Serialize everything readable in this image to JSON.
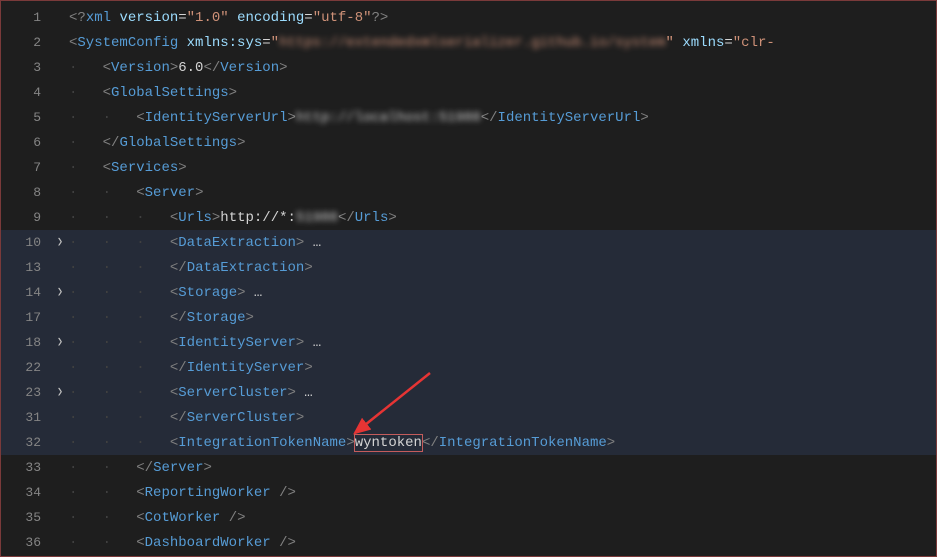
{
  "lines": [
    {
      "num": "1",
      "hl": false,
      "fold": "",
      "indent": 0,
      "tokens": [
        {
          "t": "tag-bracket",
          "v": "<?"
        },
        {
          "t": "tag-name",
          "v": "xml"
        },
        {
          "t": "text",
          "v": " "
        },
        {
          "t": "attr",
          "v": "version"
        },
        {
          "t": "text",
          "v": "="
        },
        {
          "t": "attr-val",
          "v": "\"1.0\""
        },
        {
          "t": "text",
          "v": " "
        },
        {
          "t": "attr",
          "v": "encoding"
        },
        {
          "t": "text",
          "v": "="
        },
        {
          "t": "attr-val",
          "v": "\"utf-8\""
        },
        {
          "t": "tag-bracket",
          "v": "?>"
        }
      ]
    },
    {
      "num": "2",
      "hl": false,
      "fold": "",
      "indent": 0,
      "tokens": [
        {
          "t": "tag-bracket",
          "v": "<"
        },
        {
          "t": "tag-name",
          "v": "SystemConfig"
        },
        {
          "t": "text",
          "v": " "
        },
        {
          "t": "attr",
          "v": "xmlns:sys"
        },
        {
          "t": "text",
          "v": "="
        },
        {
          "t": "attr-val",
          "v": "\""
        },
        {
          "t": "blur",
          "v": "https://extendedxmlserializer.github.io/system"
        },
        {
          "t": "attr-val",
          "v": "\""
        },
        {
          "t": "text",
          "v": " "
        },
        {
          "t": "attr",
          "v": "xmlns"
        },
        {
          "t": "text",
          "v": "="
        },
        {
          "t": "attr-val",
          "v": "\"clr-"
        }
      ]
    },
    {
      "num": "3",
      "hl": false,
      "fold": "",
      "indent": 1,
      "tokens": [
        {
          "t": "tag-bracket",
          "v": "<"
        },
        {
          "t": "tag-name",
          "v": "Version"
        },
        {
          "t": "tag-bracket",
          "v": ">"
        },
        {
          "t": "text",
          "v": "6.0"
        },
        {
          "t": "tag-bracket",
          "v": "</"
        },
        {
          "t": "tag-name",
          "v": "Version"
        },
        {
          "t": "tag-bracket",
          "v": ">"
        }
      ]
    },
    {
      "num": "4",
      "hl": false,
      "fold": "",
      "indent": 1,
      "tokens": [
        {
          "t": "tag-bracket",
          "v": "<"
        },
        {
          "t": "tag-name",
          "v": "GlobalSettings"
        },
        {
          "t": "tag-bracket",
          "v": ">"
        }
      ]
    },
    {
      "num": "5",
      "hl": false,
      "fold": "",
      "indent": 2,
      "tokens": [
        {
          "t": "tag-bracket",
          "v": "<"
        },
        {
          "t": "tag-name",
          "v": "IdentityServerUrl"
        },
        {
          "t": "tag-bracket",
          "v": ">"
        },
        {
          "t": "blur2",
          "v": "http://localhost:51980"
        },
        {
          "t": "tag-bracket",
          "v": "</"
        },
        {
          "t": "tag-name",
          "v": "IdentityServerUrl"
        },
        {
          "t": "tag-bracket",
          "v": ">"
        }
      ]
    },
    {
      "num": "6",
      "hl": false,
      "fold": "",
      "indent": 1,
      "tokens": [
        {
          "t": "tag-bracket",
          "v": "</"
        },
        {
          "t": "tag-name",
          "v": "GlobalSettings"
        },
        {
          "t": "tag-bracket",
          "v": ">"
        }
      ]
    },
    {
      "num": "7",
      "hl": false,
      "fold": "",
      "indent": 1,
      "tokens": [
        {
          "t": "tag-bracket",
          "v": "<"
        },
        {
          "t": "tag-name",
          "v": "Services"
        },
        {
          "t": "tag-bracket",
          "v": ">"
        }
      ]
    },
    {
      "num": "8",
      "hl": false,
      "fold": "",
      "indent": 2,
      "tokens": [
        {
          "t": "tag-bracket",
          "v": "<"
        },
        {
          "t": "tag-name",
          "v": "Server"
        },
        {
          "t": "tag-bracket",
          "v": ">"
        }
      ]
    },
    {
      "num": "9",
      "hl": false,
      "fold": "",
      "indent": 3,
      "tokens": [
        {
          "t": "tag-bracket",
          "v": "<"
        },
        {
          "t": "tag-name",
          "v": "Urls"
        },
        {
          "t": "tag-bracket",
          "v": ">"
        },
        {
          "t": "text",
          "v": "http://*:"
        },
        {
          "t": "blur2",
          "v": "51980"
        },
        {
          "t": "tag-bracket",
          "v": "</"
        },
        {
          "t": "tag-name",
          "v": "Urls"
        },
        {
          "t": "tag-bracket",
          "v": ">"
        }
      ]
    },
    {
      "num": "10",
      "hl": true,
      "fold": ">",
      "indent": 3,
      "tokens": [
        {
          "t": "tag-bracket",
          "v": "<"
        },
        {
          "t": "tag-name",
          "v": "DataExtraction"
        },
        {
          "t": "tag-bracket",
          "v": ">"
        },
        {
          "t": "ell",
          "v": " …"
        }
      ]
    },
    {
      "num": "13",
      "hl": true,
      "fold": "",
      "indent": 3,
      "tokens": [
        {
          "t": "tag-bracket",
          "v": "</"
        },
        {
          "t": "tag-name",
          "v": "DataExtraction"
        },
        {
          "t": "tag-bracket",
          "v": ">"
        }
      ]
    },
    {
      "num": "14",
      "hl": true,
      "fold": ">",
      "indent": 3,
      "tokens": [
        {
          "t": "tag-bracket",
          "v": "<"
        },
        {
          "t": "tag-name",
          "v": "Storage"
        },
        {
          "t": "tag-bracket",
          "v": ">"
        },
        {
          "t": "ell",
          "v": " …"
        }
      ]
    },
    {
      "num": "17",
      "hl": true,
      "fold": "",
      "indent": 3,
      "tokens": [
        {
          "t": "tag-bracket",
          "v": "</"
        },
        {
          "t": "tag-name",
          "v": "Storage"
        },
        {
          "t": "tag-bracket",
          "v": ">"
        }
      ]
    },
    {
      "num": "18",
      "hl": true,
      "fold": ">",
      "indent": 3,
      "tokens": [
        {
          "t": "tag-bracket",
          "v": "<"
        },
        {
          "t": "tag-name",
          "v": "IdentityServer"
        },
        {
          "t": "tag-bracket",
          "v": ">"
        },
        {
          "t": "ell",
          "v": " …"
        }
      ]
    },
    {
      "num": "22",
      "hl": true,
      "fold": "",
      "indent": 3,
      "tokens": [
        {
          "t": "tag-bracket",
          "v": "</"
        },
        {
          "t": "tag-name",
          "v": "IdentityServer"
        },
        {
          "t": "tag-bracket",
          "v": ">"
        }
      ]
    },
    {
      "num": "23",
      "hl": true,
      "fold": ">",
      "indent": 3,
      "tokens": [
        {
          "t": "tag-bracket",
          "v": "<"
        },
        {
          "t": "tag-name",
          "v": "ServerCluster"
        },
        {
          "t": "tag-bracket",
          "v": ">"
        },
        {
          "t": "ell",
          "v": " …"
        }
      ]
    },
    {
      "num": "31",
      "hl": true,
      "fold": "",
      "indent": 3,
      "tokens": [
        {
          "t": "tag-bracket",
          "v": "</"
        },
        {
          "t": "tag-name",
          "v": "ServerCluster"
        },
        {
          "t": "tag-bracket",
          "v": ">"
        }
      ]
    },
    {
      "num": "32",
      "hl": true,
      "fold": "",
      "indent": 3,
      "tokens": [
        {
          "t": "tag-bracket",
          "v": "<"
        },
        {
          "t": "tag-name",
          "v": "IntegrationTokenName"
        },
        {
          "t": "tag-bracket",
          "v": ">"
        },
        {
          "t": "text",
          "v": "wyntoken",
          "box": true
        },
        {
          "t": "tag-bracket",
          "v": "</"
        },
        {
          "t": "tag-name",
          "v": "IntegrationTokenName"
        },
        {
          "t": "tag-bracket",
          "v": ">"
        }
      ]
    },
    {
      "num": "33",
      "hl": false,
      "fold": "",
      "indent": 2,
      "tokens": [
        {
          "t": "tag-bracket",
          "v": "</"
        },
        {
          "t": "tag-name",
          "v": "Server"
        },
        {
          "t": "tag-bracket",
          "v": ">"
        }
      ]
    },
    {
      "num": "34",
      "hl": false,
      "fold": "",
      "indent": 2,
      "tokens": [
        {
          "t": "tag-bracket",
          "v": "<"
        },
        {
          "t": "tag-name",
          "v": "ReportingWorker"
        },
        {
          "t": "text",
          "v": " "
        },
        {
          "t": "tag-bracket",
          "v": "/>"
        }
      ]
    },
    {
      "num": "35",
      "hl": false,
      "fold": "",
      "indent": 2,
      "tokens": [
        {
          "t": "tag-bracket",
          "v": "<"
        },
        {
          "t": "tag-name",
          "v": "CotWorker"
        },
        {
          "t": "text",
          "v": " "
        },
        {
          "t": "tag-bracket",
          "v": "/>"
        }
      ]
    },
    {
      "num": "36",
      "hl": false,
      "fold": "",
      "indent": 2,
      "tokens": [
        {
          "t": "tag-bracket",
          "v": "<"
        },
        {
          "t": "tag-name",
          "v": "DashboardWorker"
        },
        {
          "t": "text",
          "v": " "
        },
        {
          "t": "tag-bracket",
          "v": "/>"
        }
      ]
    }
  ]
}
